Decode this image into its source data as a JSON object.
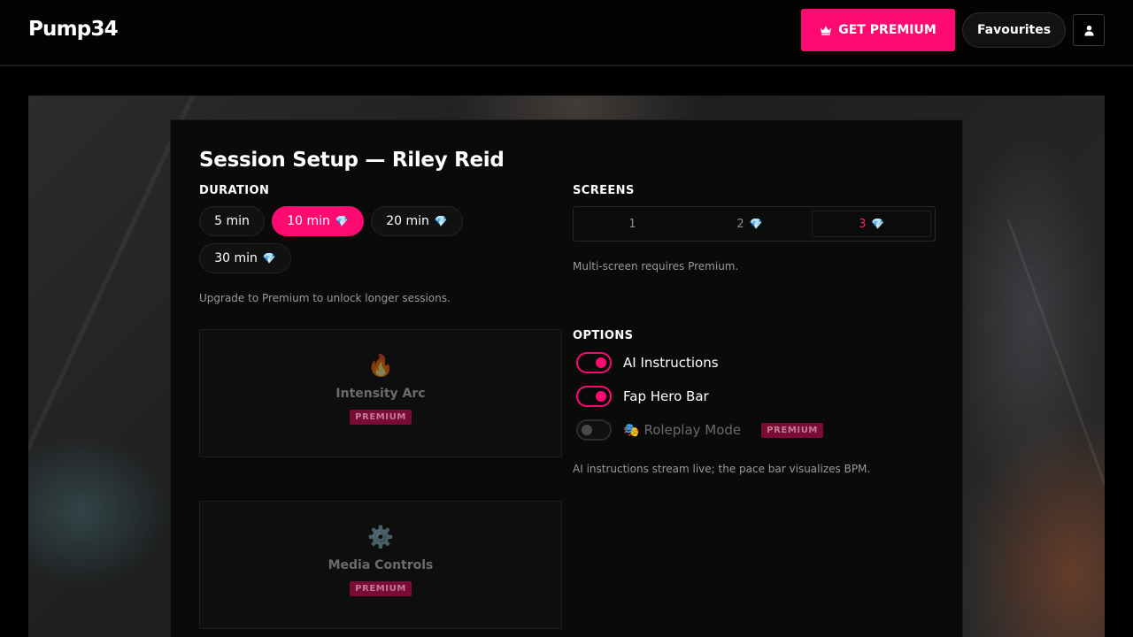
{
  "header": {
    "logo": "Pump34",
    "premium_button": "GET PREMIUM",
    "favourites_button": "Favourites",
    "user_icon": "user-icon"
  },
  "modal": {
    "title": "Session Setup — Riley Reid",
    "duration": {
      "label": "DURATION",
      "options": [
        {
          "label": "5 min",
          "premium": false,
          "selected": false
        },
        {
          "label": "10 min",
          "premium": true,
          "selected": true
        },
        {
          "label": "20 min",
          "premium": true,
          "selected": false
        },
        {
          "label": "30 min",
          "premium": true,
          "selected": false
        }
      ],
      "note": "Upgrade to Premium to unlock longer sessions."
    },
    "screens": {
      "label": "SCREENS",
      "options": [
        {
          "label": "1",
          "premium": false
        },
        {
          "label": "2",
          "premium": true
        },
        {
          "label": "3",
          "premium": true,
          "selected": true
        }
      ],
      "note": "Multi-screen requires Premium."
    },
    "cards": [
      {
        "icon": "flame-icon",
        "glyph": "🔥",
        "title": "Intensity Arc",
        "badge": "PREMIUM"
      },
      {
        "icon": "gear-icon",
        "glyph": "⚙️",
        "title": "Media Controls",
        "badge": "PREMIUM"
      }
    ],
    "options": {
      "label": "OPTIONS",
      "items": [
        {
          "label": "AI Instructions",
          "on": true
        },
        {
          "label": "Fap Hero Bar",
          "on": true
        },
        {
          "label": "🎭 Roleplay Mode",
          "on": false,
          "badge": "PREMIUM"
        }
      ],
      "note": "AI instructions stream live; the pace bar visualizes BPM."
    },
    "gem_glyph": "💎"
  },
  "colors": {
    "accent": "#ff0a71",
    "background": "#000000",
    "panel": "#0a0a0a"
  }
}
